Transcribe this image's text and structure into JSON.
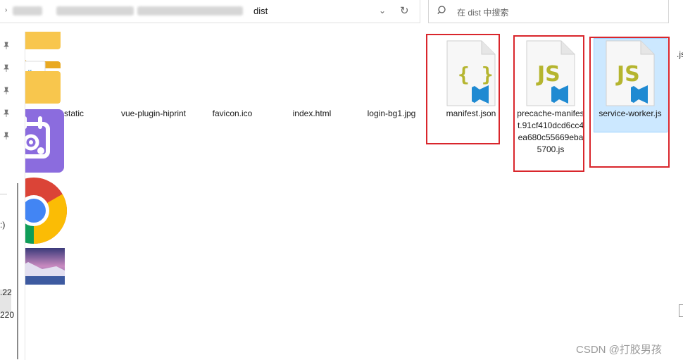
{
  "address_bar": {
    "current_folder": "dist",
    "dropdown_icon": "chevron-down-icon",
    "refresh_icon": "refresh-icon"
  },
  "search": {
    "placeholder": "在 dist 中搜索",
    "icon": "search-icon"
  },
  "nav_pane": {
    "fragments": [
      ":)",
      ".22",
      "220"
    ]
  },
  "files": [
    {
      "name": "static",
      "type": "folder"
    },
    {
      "name": "vue-plugin-hiprint",
      "type": "folder"
    },
    {
      "name": "favicon.ico",
      "type": "ico"
    },
    {
      "name": "index.html",
      "type": "html"
    },
    {
      "name": "login-bg1.jpg",
      "type": "image"
    },
    {
      "name": "manifest.json",
      "type": "json",
      "icon_text": "{ }"
    },
    {
      "name": "precache-manifest.91cf410dcd6cc4ea680c55669eba5700.js",
      "type": "js",
      "icon_text": "JS"
    },
    {
      "name": "service-worker.js",
      "type": "js",
      "icon_text": "JS",
      "selected": true
    }
  ],
  "right_fragment": ".js",
  "watermark": "CSDN @打胶男孩",
  "colors": {
    "highlight_box": "#d9262c",
    "selection": "#cce8ff",
    "folder": "#f8c64d",
    "vscode_blue": "#1f8ad2",
    "js_text": "#b5b52f"
  }
}
